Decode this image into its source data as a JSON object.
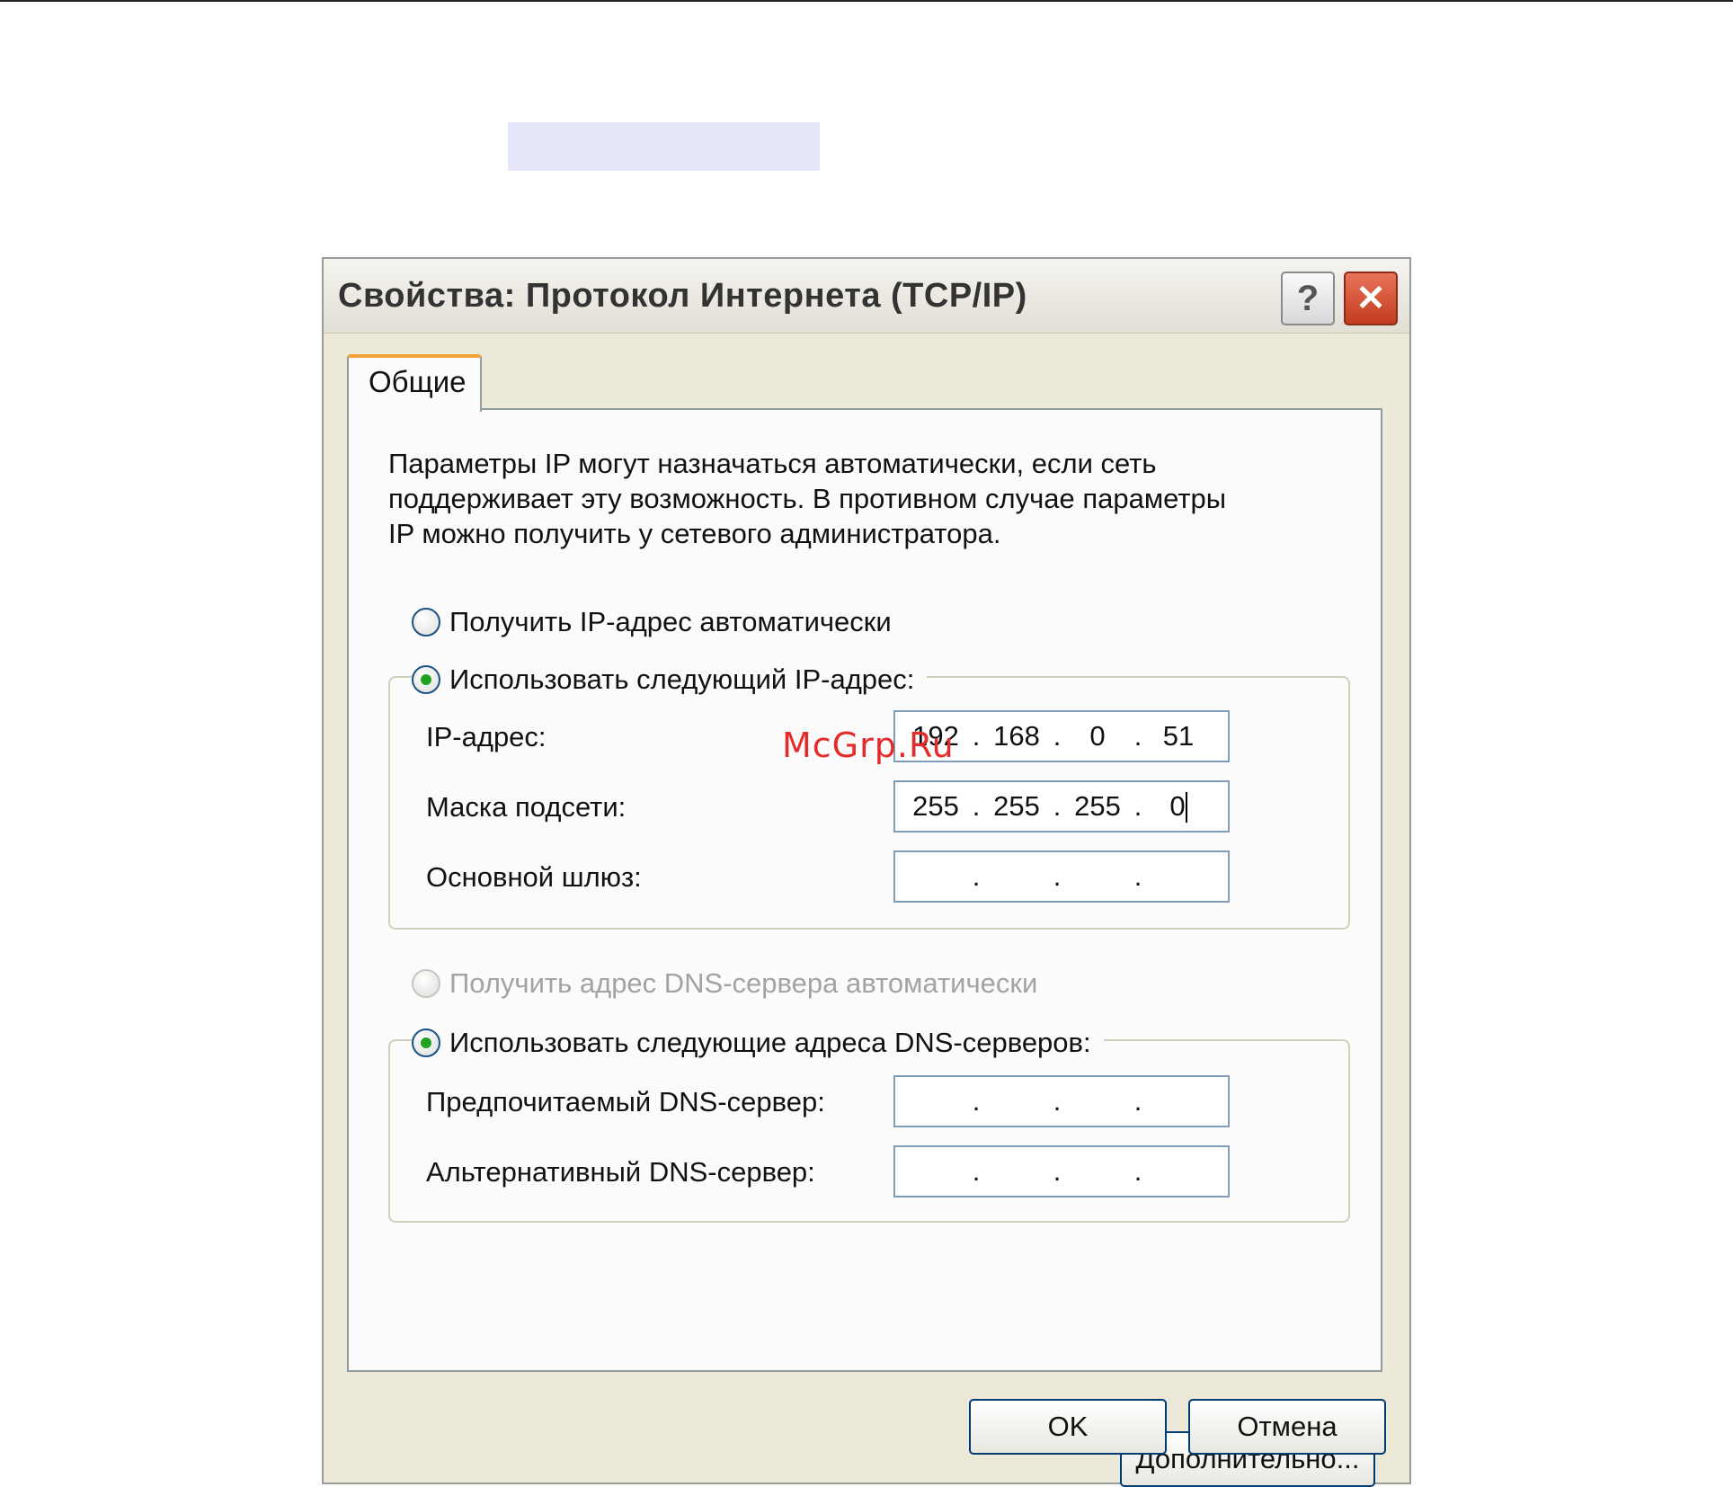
{
  "window": {
    "title": "Свойства: Протокол Интернета (TCP/IP)",
    "help_glyph": "?",
    "close_glyph": "✕"
  },
  "tabs": [
    {
      "label": "Общие",
      "selected": true
    }
  ],
  "intro": {
    "lines": [
      "Параметры IP могут назначаться автоматически, если сеть",
      "поддерживает эту возможность. В противном случае параметры",
      "IP можно получить у сетевого администратора."
    ]
  },
  "ip_section": {
    "auto_label": "Получить IP-адрес автоматически",
    "manual_label": "Использовать следующий IP-адрес:",
    "selected": "manual",
    "fields": [
      {
        "label": "IP-адрес:",
        "octets": [
          "192",
          "168",
          "0",
          "51"
        ]
      },
      {
        "label": "Маска подсети:",
        "octets": [
          "255",
          "255",
          "255",
          "0"
        ]
      },
      {
        "label": "Основной шлюз:",
        "octets": [
          "",
          "",
          "",
          ""
        ]
      }
    ]
  },
  "dns_section": {
    "auto_label": "Получить адрес DNS-сервера автоматически",
    "manual_label": "Использовать следующие адреса DNS-серверов:",
    "selected": "manual",
    "auto_disabled": true,
    "fields": [
      {
        "label": "Предпочитаемый DNS-сервер:",
        "octets": [
          "",
          "",
          "",
          ""
        ]
      },
      {
        "label": "Альтернативный DNS-сервер:",
        "octets": [
          "",
          "",
          "",
          ""
        ]
      }
    ]
  },
  "buttons": {
    "advanced": "Дополнительно...",
    "ok": "OK",
    "cancel": "Отмена"
  },
  "watermark": "McGrp.Ru",
  "dot": "."
}
